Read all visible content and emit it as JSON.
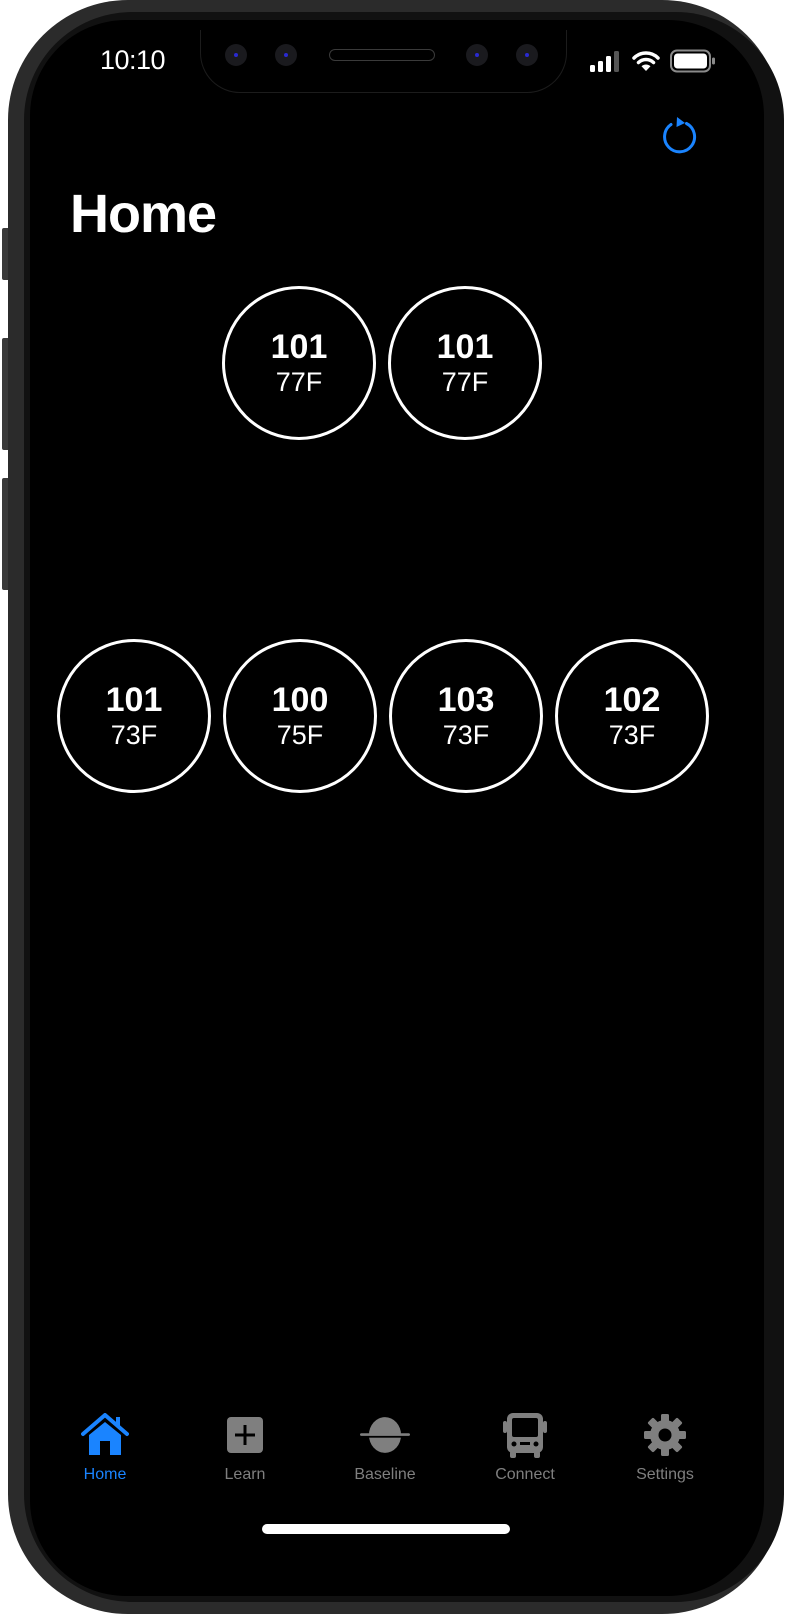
{
  "status_bar": {
    "time": "10:10",
    "signal_icon": "cellular-signal-icon",
    "wifi_icon": "wifi-icon",
    "battery_icon": "battery-icon"
  },
  "header": {
    "refresh_icon": "refresh-icon",
    "title": "Home"
  },
  "devices": {
    "top_row": [
      {
        "id": "101",
        "temp": "77F"
      },
      {
        "id": "101",
        "temp": "77F"
      }
    ],
    "bottom_row": [
      {
        "id": "101",
        "temp": "73F"
      },
      {
        "id": "100",
        "temp": "75F"
      },
      {
        "id": "103",
        "temp": "73F"
      },
      {
        "id": "102",
        "temp": "73F"
      }
    ]
  },
  "tab_bar": {
    "active": "Home",
    "active_color": "#1a84ff",
    "inactive_color": "#7f7f7f",
    "items": [
      {
        "label": "Home",
        "icon": "house-icon"
      },
      {
        "label": "Learn",
        "icon": "plus-card-icon"
      },
      {
        "label": "Baseline",
        "icon": "baseline-icon"
      },
      {
        "label": "Connect",
        "icon": "bus-icon"
      },
      {
        "label": "Settings",
        "icon": "gear-icon"
      }
    ]
  }
}
